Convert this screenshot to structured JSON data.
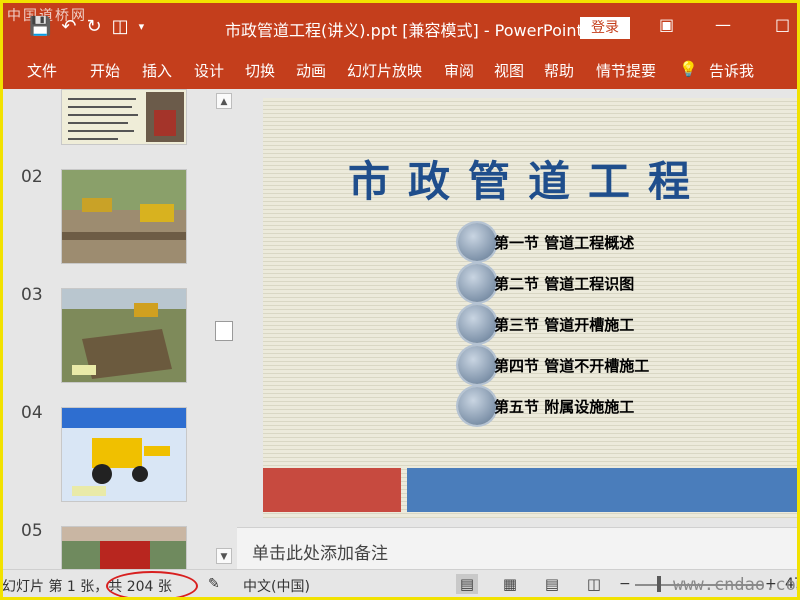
{
  "watermark_top": "中国道桥网",
  "titlebar": {
    "doc_title": "市政管道工程(讲义).ppt [兼容模式]  -  PowerPoint",
    "login_label": "登录"
  },
  "ribbon": {
    "tabs": [
      "文件",
      "开始",
      "插入",
      "设计",
      "切换",
      "动画",
      "幻灯片放映",
      "审阅",
      "视图",
      "帮助",
      "情节提要"
    ],
    "tell_me": "告诉我"
  },
  "thumbnails": {
    "numbers": [
      "02",
      "03",
      "04",
      "05"
    ]
  },
  "slide": {
    "title": "市政管道工程",
    "agenda": [
      "第一节  管道工程概述",
      "第二节  管道工程识图",
      "第三节  管道开槽施工",
      "第四节  管道不开槽施工",
      "第五节  附属设施施工"
    ]
  },
  "notes": {
    "placeholder": "单击此处添加备注"
  },
  "statusbar": {
    "slide_info": "幻灯片 第 1 张，共 204 张",
    "language": "中文(中国)",
    "zoom_tail": "47"
  },
  "watermark_bottom": "www.cndao.com",
  "colors": {
    "accent": "#c43e1c",
    "slide_title": "#1f4e8c",
    "bar_red": "#c74a3f",
    "bar_blue": "#4a7dbb",
    "annotation": "#d81f1f"
  }
}
